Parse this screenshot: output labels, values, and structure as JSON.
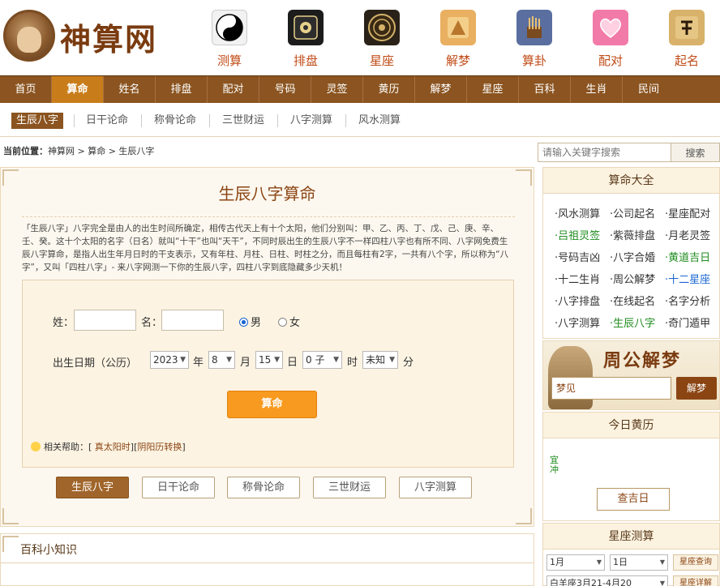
{
  "brand": {
    "name": "神算网"
  },
  "topnav": [
    {
      "label": "测算",
      "icon": "yinyang-icon",
      "color": "#f2f2f2"
    },
    {
      "label": "排盘",
      "icon": "bagua-icon",
      "color": "#1c1c1c"
    },
    {
      "label": "星座",
      "icon": "zodiac-wheel-icon",
      "color": "#2a2218"
    },
    {
      "label": "解梦",
      "icon": "zhougong-icon",
      "color": "#e8b060"
    },
    {
      "label": "算卦",
      "icon": "bamboo-sticks-icon",
      "color": "#5a6fa0"
    },
    {
      "label": "配对",
      "icon": "heart-pair-icon",
      "color": "#f27aa8"
    },
    {
      "label": "起名",
      "icon": "name-char-icon",
      "color": "#d8b26a"
    }
  ],
  "menu": [
    "首页",
    "算命",
    "姓名",
    "排盘",
    "配对",
    "号码",
    "灵签",
    "黄历",
    "解梦",
    "星座",
    "百科",
    "生肖",
    "民间"
  ],
  "submenu": [
    "生辰八字",
    "日干论命",
    "称骨论命",
    "三世财运",
    "八字测算",
    "风水测算"
  ],
  "breadcrumb": {
    "prefix": "当前位置：",
    "path": "神算网 > 算命 > 生辰八字"
  },
  "search": {
    "placeholder": "请输入关键字搜索",
    "button": "搜索"
  },
  "main": {
    "title": "生辰八字算命",
    "intro": "「生辰八字」八字完全是由人的出生时间所确定，相传古代天上有十个太阳，他们分别叫：甲、乙、丙、丁、戊、己、庚、辛、壬、癸。这十个太阳的名字（日名）就叫“十干”也叫“天干”，不同时辰出生的生辰八字不一样四柱八字也有所不同、八字网免费生辰八字算命，是指人出生年月日时的干支表示，又有年柱、月柱、日柱、时柱之分，而且每柱有2字，一共有八个字，所以称为“八字”，又叫「四柱八字」- 来八字网测一下你的生辰八字，四柱八字到底隐藏多少天机！",
    "form": {
      "surname_label": "姓：",
      "name_label": "名：",
      "male": "男",
      "female": "女",
      "birth_label": "出生日期（公历）",
      "year": "2023",
      "year_unit": "年",
      "month": "8",
      "month_unit": "月",
      "day": "15",
      "day_unit": "日",
      "hour": "0 子",
      "hour_unit": "时",
      "minute": "未知",
      "minute_unit": "分",
      "submit": "算命"
    },
    "help": {
      "label": "相关帮助：",
      "open": "[",
      "mid": "][",
      "close": "]",
      "link1": "真太阳时",
      "link2": "阴阳历转换"
    },
    "tabs": [
      "生辰八字",
      "日干论命",
      "称骨论命",
      "三世财运",
      "八字测算"
    ]
  },
  "knowledge": {
    "title": "百科小知识"
  },
  "side_suanming": {
    "title": "算命大全",
    "links": [
      {
        "text": "·风水测算",
        "color": "normal"
      },
      {
        "text": "·公司起名",
        "color": "normal"
      },
      {
        "text": "·星座配对",
        "color": "normal"
      },
      {
        "text": "·吕祖灵签",
        "color": "green"
      },
      {
        "text": "·紫薇排盘",
        "color": "normal"
      },
      {
        "text": "·月老灵签",
        "color": "normal"
      },
      {
        "text": "·号码吉凶",
        "color": "normal"
      },
      {
        "text": "·八字合婚",
        "color": "normal"
      },
      {
        "text": "·黄道吉日",
        "color": "green"
      },
      {
        "text": "·十二生肖",
        "color": "normal"
      },
      {
        "text": "·周公解梦",
        "color": "normal"
      },
      {
        "text": "·十二星座",
        "color": "blue"
      },
      {
        "text": "·八字排盘",
        "color": "normal"
      },
      {
        "text": "·在线起名",
        "color": "normal"
      },
      {
        "text": "·名字分析",
        "color": "normal"
      },
      {
        "text": "·八字测算",
        "color": "normal"
      },
      {
        "text": "·生辰八字",
        "color": "green"
      },
      {
        "text": "·奇门遁甲",
        "color": "normal"
      }
    ]
  },
  "zhougong": {
    "title": "周公解梦",
    "placeholder": "梦见",
    "button": "解梦"
  },
  "huangli": {
    "title": "今日黄历",
    "yi": "宜",
    "ji": "冲",
    "button": "查吉日"
  },
  "xingzuo": {
    "title": "星座测算",
    "month": "1月",
    "day": "1日",
    "query": "星座查询",
    "sign": "白羊座3月21-4月20",
    "detail": "星座详解"
  }
}
